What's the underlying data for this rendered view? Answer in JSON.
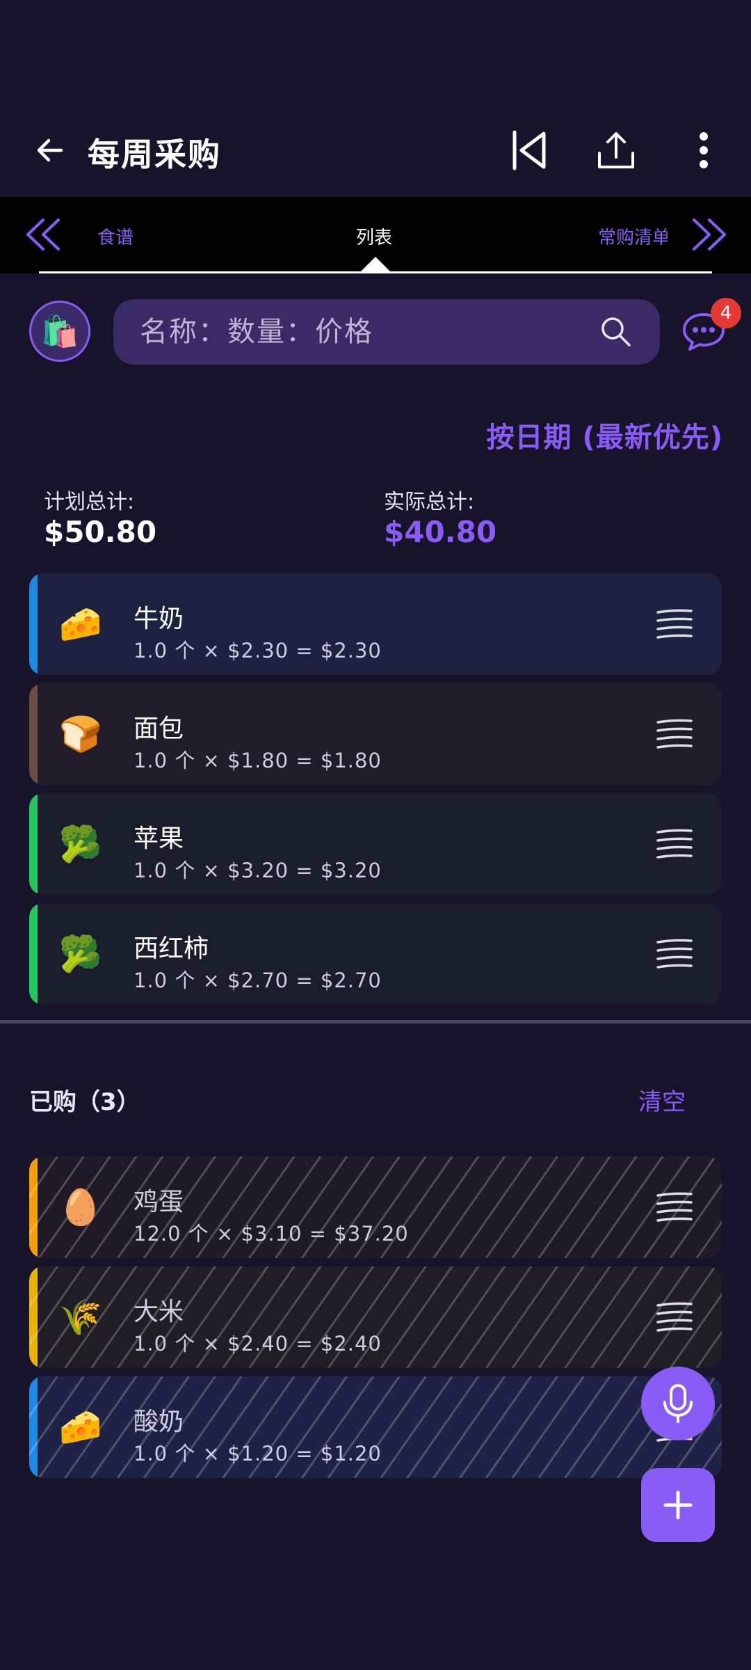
{
  "header": {
    "title": "每周采购"
  },
  "tabs": {
    "left": "食谱",
    "center": "列表",
    "right": "常购清单"
  },
  "search": {
    "placeholder": "名称：数量：价格"
  },
  "chat": {
    "badge_count": "4"
  },
  "sort_label": "按日期 (最新优先)",
  "totals": {
    "planned_label": "计划总计:",
    "planned_value": "$50.80",
    "actual_label": "实际总计:",
    "actual_value": "$40.80"
  },
  "items": [
    {
      "emoji": "🧀",
      "name": "牛奶",
      "detail": "1.0 个 × $2.30 = $2.30",
      "accent": "#1e88e5",
      "bg": "#1c2240"
    },
    {
      "emoji": "🍞",
      "name": "面包",
      "detail": "1.0 个 × $1.80 = $1.80",
      "accent": "#6d4c41",
      "bg": "#211b2a"
    },
    {
      "emoji": "🥦",
      "name": "苹果",
      "detail": "1.0 个 × $3.20 = $3.20",
      "accent": "#22c55e",
      "bg": "#191d2c"
    },
    {
      "emoji": "🥦",
      "name": "西红柿",
      "detail": "1.0 个 × $2.70 = $2.70",
      "accent": "#22c55e",
      "bg": "#191d2c"
    }
  ],
  "bought": {
    "header": "已购（3）",
    "clear_label": "清空",
    "items": [
      {
        "emoji": "🥚",
        "name": "鸡蛋",
        "detail": "12.0 个 × $3.10 = $37.20",
        "accent": "#f59e0b",
        "bg": "#201a26"
      },
      {
        "emoji": "🌾",
        "name": "大米",
        "detail": "1.0 个 × $2.40 = $2.40",
        "accent": "#eab308",
        "bg": "#211d24"
      },
      {
        "emoji": "🧀",
        "name": "酸奶",
        "detail": "1.0 个 × $1.20 = $1.20",
        "accent": "#1e88e5",
        "bg": "#1d2246"
      }
    ]
  },
  "colors": {
    "accent": "#8a5cf6",
    "background": "#16132a"
  }
}
